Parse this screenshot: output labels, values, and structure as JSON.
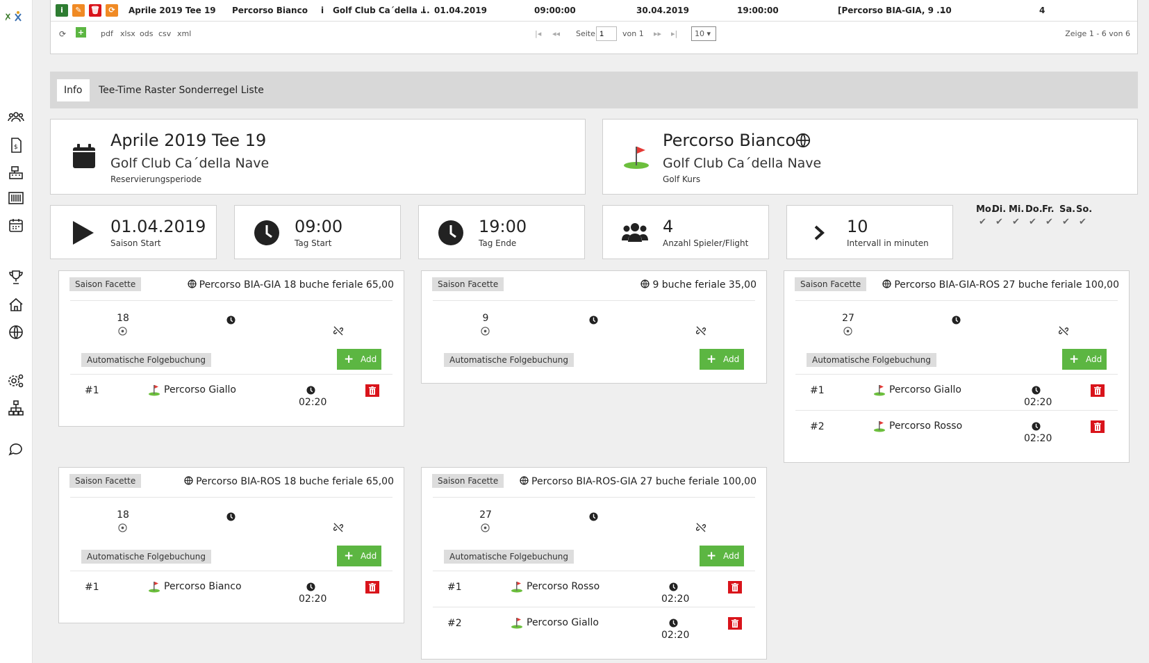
{
  "grid": {
    "row": {
      "name": "Aprile 2019 Tee 19",
      "course": "Percorso Bianco",
      "club": "Golf Club Ca´della ...",
      "start_date": "01.04.2019",
      "start_time": "09:00:00",
      "end_date": "30.04.2019",
      "end_time": "19:00:00",
      "facettes": "[Percorso BIA-GIA, 9 ...",
      "interval": "10",
      "players": "4"
    },
    "pager": {
      "exports": [
        "pdf",
        "xlsx",
        "ods",
        "csv",
        "xml"
      ],
      "page_label": "Seite",
      "page_value": "1",
      "of_label": "von 1",
      "page_size": "10",
      "summary": "Zeige 1 - 6 von 6"
    }
  },
  "tabs": [
    {
      "label": "Info",
      "active": true
    },
    {
      "label": "Tee-Time Raster Sonderregel Liste",
      "active": false
    }
  ],
  "period_card": {
    "title": "Aprile 2019 Tee 19",
    "club": "Golf Club Ca´della Nave",
    "type": "Reservierungsperiode"
  },
  "course_card": {
    "title": "Percorso Bianco",
    "club": "Golf Club Ca´della Nave",
    "type": "Golf Kurs"
  },
  "stats": [
    {
      "value": "01.04.2019",
      "label": "Saison Start",
      "icon": "play-icon"
    },
    {
      "value": "09:00",
      "label": "Tag Start",
      "icon": "clock-icon"
    },
    {
      "value": "19:00",
      "label": "Tag Ende",
      "icon": "clock-icon"
    },
    {
      "value": "4",
      "label": "Anzahl Spieler/Flight",
      "icon": "users-icon"
    },
    {
      "value": "10",
      "label": "Intervall in minuten",
      "icon": "chevron-right-icon"
    }
  ],
  "weekdays": [
    "Mo.",
    "Di.",
    "Mi.",
    "Do.",
    "Fr.",
    "Sa.",
    "So."
  ],
  "facettes": [
    {
      "badge": "Saison Facette",
      "title": "Percorso BIA-GIA 18 buche feriale 65,00",
      "holes": "18",
      "folge_label": "Automatische Folgebuchung",
      "add_label": "Add",
      "rows": [
        {
          "num": "#1",
          "course": "Percorso Giallo",
          "time": "02:20"
        }
      ]
    },
    {
      "badge": "Saison Facette",
      "title": "9 buche feriale 35,00",
      "holes": "9",
      "folge_label": "Automatische Folgebuchung",
      "add_label": "Add",
      "rows": []
    },
    {
      "badge": "Saison Facette",
      "title": "Percorso BIA-GIA-ROS 27 buche feriale 100,00",
      "holes": "27",
      "folge_label": "Automatische Folgebuchung",
      "add_label": "Add",
      "rows": [
        {
          "num": "#1",
          "course": "Percorso Giallo",
          "time": "02:20"
        },
        {
          "num": "#2",
          "course": "Percorso Rosso",
          "time": "02:20"
        }
      ]
    },
    {
      "badge": "Saison Facette",
      "title": "Percorso BIA-ROS 18 buche feriale 65,00",
      "holes": "18",
      "folge_label": "Automatische Folgebuchung",
      "add_label": "Add",
      "rows": [
        {
          "num": "#1",
          "course": "Percorso Bianco",
          "time": "02:20"
        }
      ]
    },
    {
      "badge": "Saison Facette",
      "title": "Percorso BIA-ROS-GIA 27 buche feriale 100,00",
      "holes": "27",
      "folge_label": "Automatische Folgebuchung",
      "add_label": "Add",
      "rows": [
        {
          "num": "#1",
          "course": "Percorso Rosso",
          "time": "02:20"
        },
        {
          "num": "#2",
          "course": "Percorso Giallo",
          "time": "02:20"
        }
      ]
    }
  ],
  "colors": {
    "accent_green": "#5cb642",
    "delete_red": "#d9141b",
    "edit_orange": "#f08a24",
    "info_green": "#2e7d32"
  }
}
